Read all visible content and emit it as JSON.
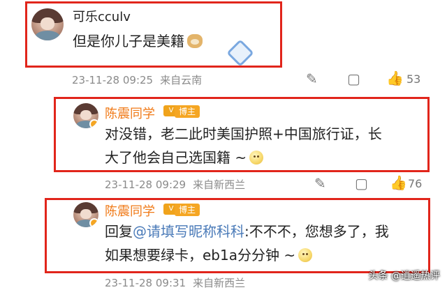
{
  "comments": [
    {
      "username": "可乐cculv",
      "text": "但是你儿子是美籍",
      "time": "23-11-28 09:25",
      "location": "来自云南",
      "likes": "53"
    },
    {
      "username": "陈震同学",
      "vip": "V",
      "tag": "博主",
      "line1": "对没错，老二此时美国护照+中国旅行证，长",
      "line2": "大了他会自己选国籍 ~",
      "time": "23-11-28 09:29",
      "location": "来自新西兰",
      "likes": "76"
    },
    {
      "username": "陈震同学",
      "vip": "V",
      "tag": "博主",
      "reply_prefix": "回复",
      "mention": "@请填写昵称科科",
      "reply_text": ":不不不，您想多了，我",
      "line2": "如果想要绿卡，eb1a分分钟 ~",
      "time": "23-11-28 09:31",
      "location": "来自新西兰"
    }
  ],
  "watermark": "头条 @逍遥热评",
  "icons": [
    "comment-icon",
    "like-icon",
    "forward-icon"
  ]
}
